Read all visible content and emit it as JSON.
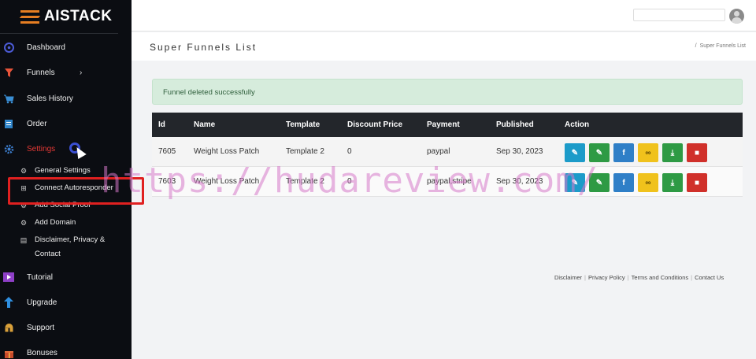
{
  "brand": {
    "logo_text": "AISTACK"
  },
  "sidebar": {
    "items": [
      {
        "label": "Dashboard",
        "icon": "dashboard-icon"
      },
      {
        "label": "Funnels",
        "icon": "funnel-icon"
      },
      {
        "label": "Sales History",
        "icon": "cart-icon"
      },
      {
        "label": "Order",
        "icon": "order-icon"
      },
      {
        "label": "Settings",
        "icon": "gear-icon"
      },
      {
        "label": "Tutorial",
        "icon": "video-icon"
      },
      {
        "label": "Upgrade",
        "icon": "upgrade-arrow-icon"
      },
      {
        "label": "Support",
        "icon": "support-icon"
      },
      {
        "label": "Bonuses",
        "icon": "gift-icon"
      }
    ],
    "settings_sub": [
      {
        "label": "General Settings",
        "icon": "gears-icon"
      },
      {
        "label": "Connect Autoresponder",
        "icon": "plug-icon"
      },
      {
        "label": "Add Social Proof",
        "icon": "gears-icon"
      },
      {
        "label": "Add Domain",
        "icon": "gears-icon"
      },
      {
        "label": "Disclaimer, Privacy &",
        "label2": "Contact",
        "icon": "document-icon"
      }
    ]
  },
  "page": {
    "title": "Super Funnels List",
    "breadcrumb": "Super Funnels List",
    "alert": "Funnel deleted successfully"
  },
  "table": {
    "headers": [
      "Id",
      "Name",
      "Template",
      "Discount Price",
      "Payment",
      "Published",
      "Action"
    ],
    "rows": [
      {
        "id": "7605",
        "name": "Weight Loss Patch",
        "template": "Template 2",
        "discount": "0",
        "payment": "paypal",
        "published": "Sep 30, 2023"
      },
      {
        "id": "7603",
        "name": "Weight Loss Patch",
        "template": "Template 2",
        "discount": "0",
        "payment": "paypal,stripe",
        "published": "Sep 30, 2023"
      }
    ]
  },
  "footer": {
    "links": [
      "Disclaimer",
      "Privacy Policy",
      "Terms and Conditions",
      "Contact Us"
    ]
  },
  "watermark": "https://hudareview.com/",
  "colors": {
    "sidebar_bg": "#0b0d12",
    "accent": "#e67e22",
    "active_red": "#e53935",
    "table_header": "#23262b",
    "alert_bg": "#d6ecdc"
  }
}
